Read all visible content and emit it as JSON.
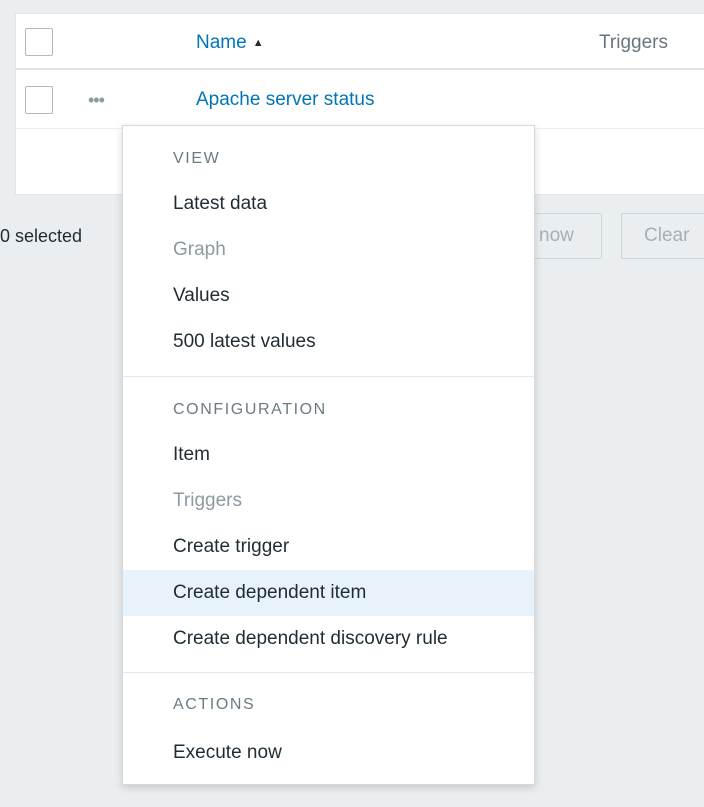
{
  "table": {
    "header": {
      "name_label": "Name",
      "sort_icon": "▲",
      "triggers_label": "Triggers"
    },
    "rows": [
      {
        "dots_icon": "•••",
        "name": "Apache server status"
      }
    ]
  },
  "action_bar": {
    "selected_count": "0 selected",
    "execute_label": "now",
    "clear_label": "Clear"
  },
  "context_menu": {
    "sections": [
      {
        "title": "VIEW",
        "items": [
          {
            "label": "Latest data",
            "disabled": false
          },
          {
            "label": "Graph",
            "disabled": true
          },
          {
            "label": "Values",
            "disabled": false
          },
          {
            "label": "500 latest values",
            "disabled": false
          }
        ]
      },
      {
        "title": "CONFIGURATION",
        "items": [
          {
            "label": "Item",
            "disabled": false
          },
          {
            "label": "Triggers",
            "disabled": true
          },
          {
            "label": "Create trigger",
            "disabled": false
          },
          {
            "label": "Create dependent item",
            "disabled": false,
            "highlighted": true
          },
          {
            "label": "Create dependent discovery rule",
            "disabled": false
          }
        ]
      },
      {
        "title": "ACTIONS",
        "items": [
          {
            "label": "Execute now",
            "disabled": false
          }
        ]
      }
    ]
  },
  "colors": {
    "link": "#0275b8",
    "background": "#ebeef0",
    "highlight": "#e7f2fb",
    "disabled_text": "#8c9aa1"
  }
}
